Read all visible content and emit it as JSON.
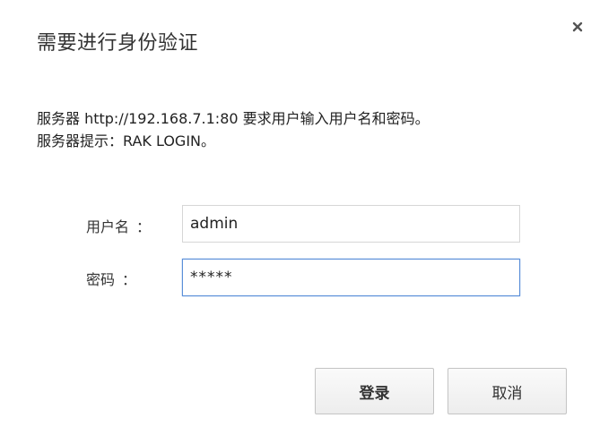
{
  "dialog": {
    "title": "需要进行身份验证",
    "close_icon": "close-icon",
    "message_line1": "服务器 http://192.168.7.1:80 要求用户输入用户名和密码。",
    "message_line2": "服务器提示：RAK LOGIN。"
  },
  "form": {
    "username_label": "用户名",
    "username_sep": "：",
    "username_value": "admin",
    "password_label": "密码",
    "password_sep": "：",
    "password_value": "*****"
  },
  "buttons": {
    "login_label": "登录",
    "cancel_label": "取消"
  },
  "colors": {
    "focus_border": "#5b8fd9",
    "input_border": "#d6d6d6",
    "button_border": "#c4c4c4"
  }
}
